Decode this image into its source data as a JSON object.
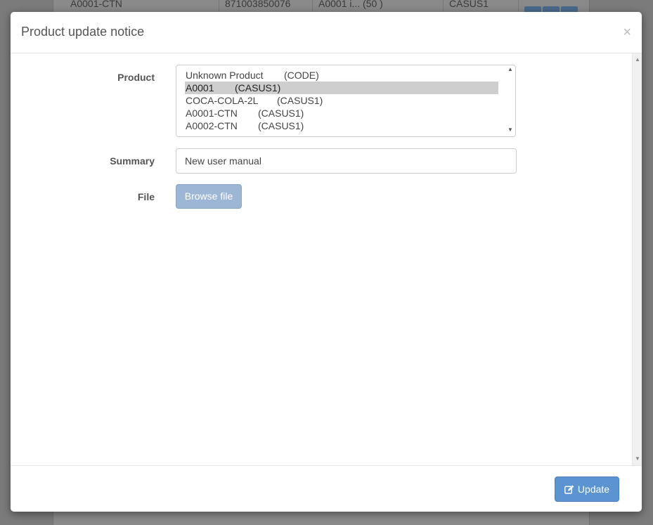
{
  "background": {
    "row": {
      "code": "A0001-CTN",
      "barcode": "871003850076",
      "description": "A0001 i...    (50    )",
      "code2": "CASUS1"
    }
  },
  "modal": {
    "title": "Product update notice",
    "close_label": "×"
  },
  "form": {
    "product_label": "Product",
    "products": [
      {
        "name": "Unknown Product",
        "code": "(CODE)"
      },
      {
        "name": "A0001",
        "code": "(CASUS1)"
      },
      {
        "name": "COCA-COLA-2L",
        "code": "(CASUS1)"
      },
      {
        "name": "A0001-CTN",
        "code": "(CASUS1)"
      },
      {
        "name": "A0002-CTN",
        "code": "(CASUS1)"
      }
    ],
    "selected_product": "A0001",
    "summary_label": "Summary",
    "summary_value": "New user manual",
    "file_label": "File",
    "browse_label": "Browse file"
  },
  "footer": {
    "update_label": "Update"
  },
  "colors": {
    "primary": "#5b94d0",
    "primary_disabled": "#9db6d5",
    "selected_option_bg": "#cecece"
  },
  "icons": {
    "update": "edit-icon"
  }
}
